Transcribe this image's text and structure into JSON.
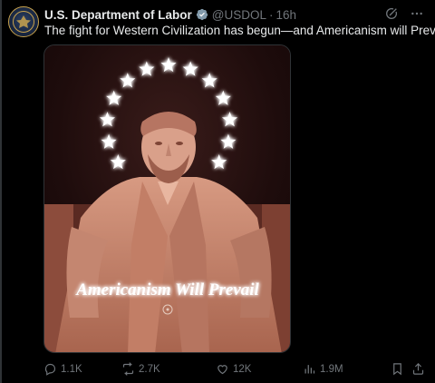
{
  "account": {
    "name": "U.S. Department of Labor",
    "handle": "@USDOL",
    "time": "16h",
    "verified_color": "#829aab"
  },
  "tweet": {
    "text": "The fight for Western Civilization has begun—and Americanism will Prevail."
  },
  "media": {
    "caption": "Americanism Will Prevail",
    "star_count": 13,
    "subject": "Lincoln Memorial statue"
  },
  "metrics": {
    "replies": "1.1K",
    "reposts": "2.7K",
    "likes": "12K",
    "views": "1.9M"
  },
  "colors": {
    "background": "#000000",
    "text": "#e7e9ea",
    "muted": "#71767b",
    "border": "#2f3336"
  },
  "icons": [
    "grok-icon",
    "more-icon",
    "reply-icon",
    "repost-icon",
    "like-icon",
    "views-icon",
    "bookmark-icon",
    "share-icon"
  ]
}
